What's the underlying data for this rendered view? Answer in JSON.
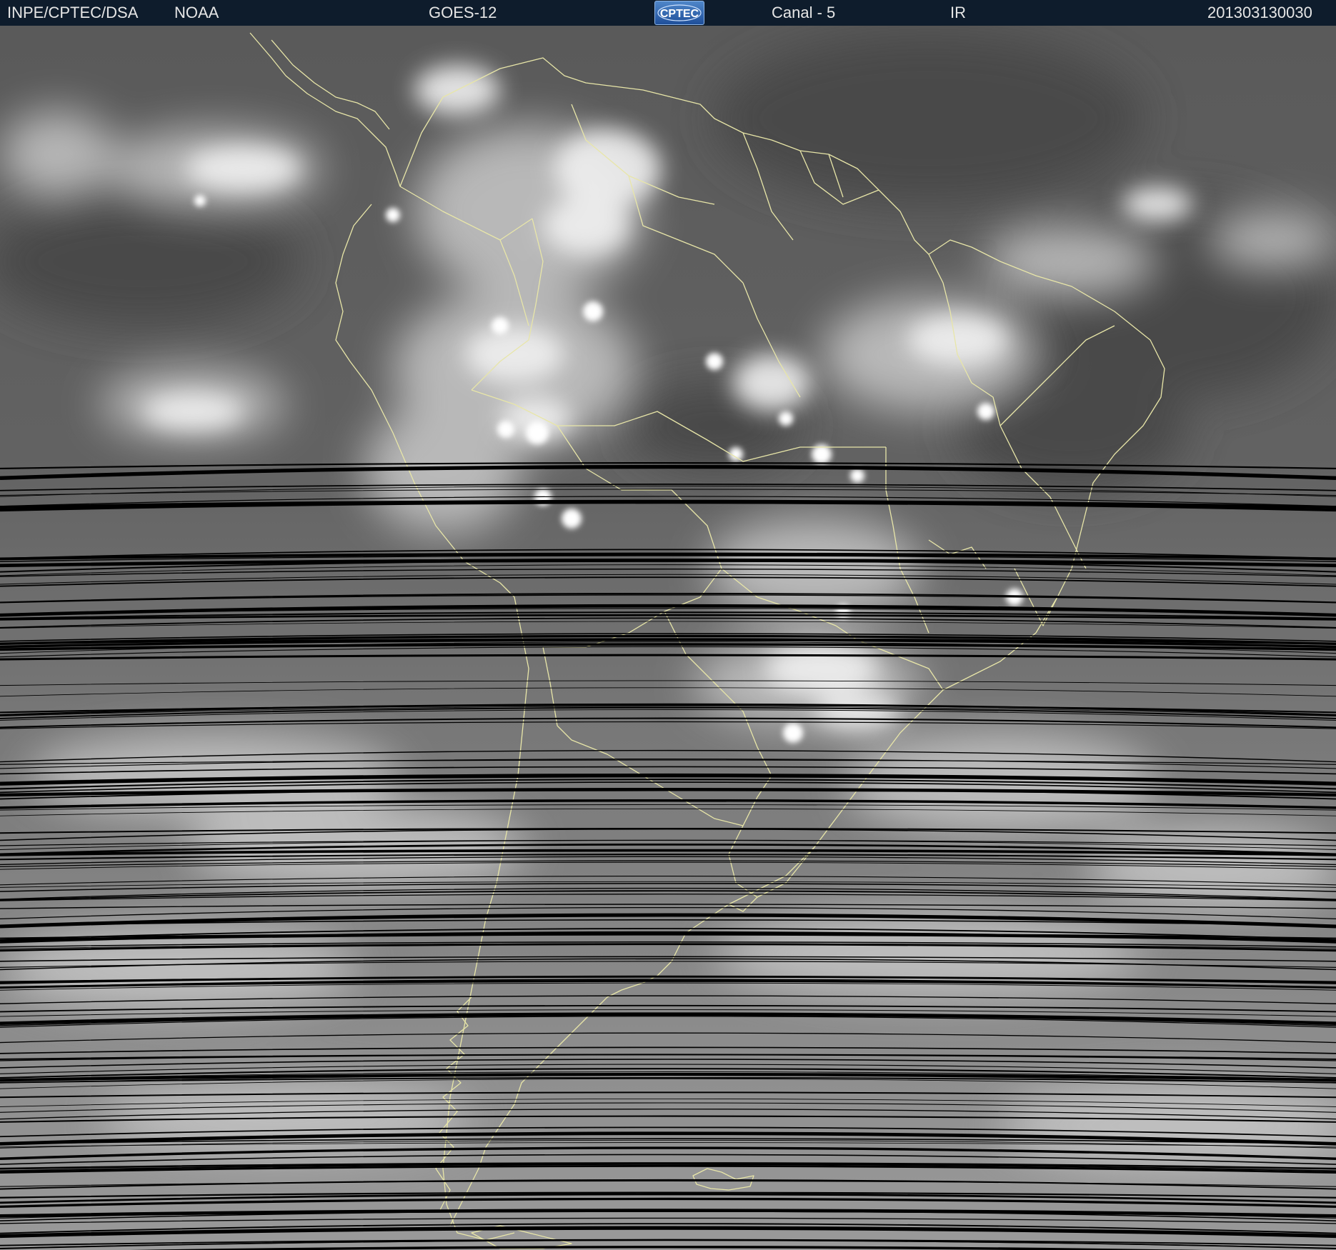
{
  "header": {
    "agency": "INPE/CPTEC/DSA",
    "source": "NOAA",
    "satellite": "GOES-12",
    "logo_text": "CPTEC",
    "channel": "Canal - 5",
    "band": "IR",
    "timestamp": "201303130030"
  },
  "colors": {
    "header_bg": "#0e1c2c",
    "header_text": "#e6e6e6",
    "ocean_gray": "#6e6e6e",
    "cloud_white": "#f2f2f2",
    "border_lines": "#e8e6a8",
    "scan_artifacts": "#000000"
  },
  "icons": {
    "logo": "cptec-logo"
  }
}
